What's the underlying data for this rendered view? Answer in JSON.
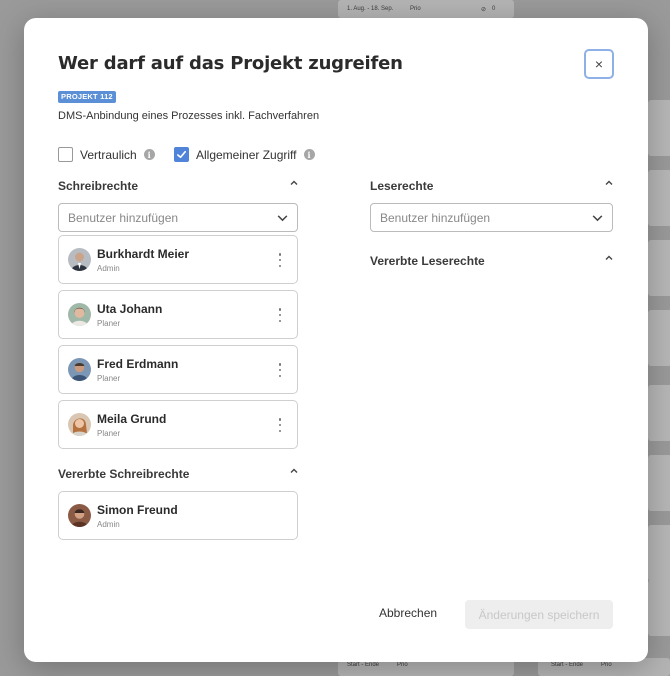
{
  "background": {
    "top_card_date": "1. Aug. - 18. Sep.",
    "top_card_prio": "Prio",
    "top_card_count": "0",
    "bottom_card_date": "Start - Ende",
    "bottom_card_prio": "Prio",
    "bottom_right_date": "Start - Ende",
    "bottom_right_prio": "Prio"
  },
  "modal": {
    "title": "Wer darf auf das Projekt zugreifen",
    "close_glyph": "×",
    "project_badge": "PROJEKT 112",
    "subtitle": "DMS-Anbindung eines Prozesses inkl. Fachverfahren",
    "checkboxes": [
      {
        "label": "Vertraulich",
        "checked": false
      },
      {
        "label": "Allgemeiner Zugriff",
        "checked": true
      }
    ],
    "write": {
      "title": "Schreibrechte",
      "add_placeholder": "Benutzer hinzufügen",
      "users": [
        {
          "name": "Burkhardt Meier",
          "role": "Admin"
        },
        {
          "name": "Uta Johann",
          "role": "Planer"
        },
        {
          "name": "Fred Erdmann",
          "role": "Planer"
        },
        {
          "name": "Meila Grund",
          "role": "Planer"
        }
      ]
    },
    "inherited_write": {
      "title": "Vererbte Schreibrechte",
      "users": [
        {
          "name": "Simon Freund",
          "role": "Admin"
        }
      ]
    },
    "read": {
      "title": "Leserechte",
      "add_placeholder": "Benutzer hinzufügen"
    },
    "inherited_read": {
      "title": "Vererbte Leserechte"
    },
    "footer": {
      "cancel_label": "Abbrechen",
      "save_label": "Änderungen speichern"
    }
  },
  "colors": {
    "accent": "#4f84d9",
    "badge": "#5b8fd6",
    "close_border": "#8fb0e6"
  }
}
